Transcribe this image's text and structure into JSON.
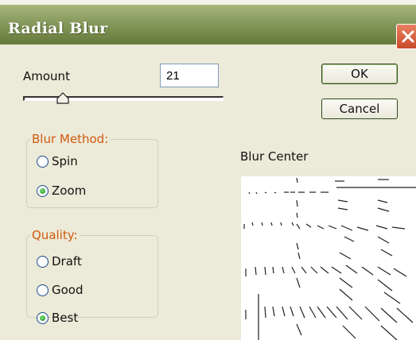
{
  "window": {
    "title": "Radial Blur"
  },
  "amount": {
    "label": "Amount",
    "value": "21",
    "slider_fraction": 0.2
  },
  "buttons": {
    "ok": "OK",
    "cancel": "Cancel"
  },
  "blur_method": {
    "legend": "Blur Method:",
    "options": [
      "Spin",
      "Zoom"
    ],
    "selected": "Zoom"
  },
  "quality": {
    "legend": "Quality:",
    "options": [
      "Draft",
      "Good",
      "Best"
    ],
    "selected": "Best"
  },
  "blur_center": {
    "label": "Blur Center"
  },
  "colors": {
    "title_bar": "#768a4c",
    "dialog_bg": "#ecead8",
    "group_legend": "#d05a10",
    "close_button": "#c94a2c"
  },
  "icons": {
    "close": "close-icon",
    "slider_thumb": "slider-thumb-icon"
  }
}
